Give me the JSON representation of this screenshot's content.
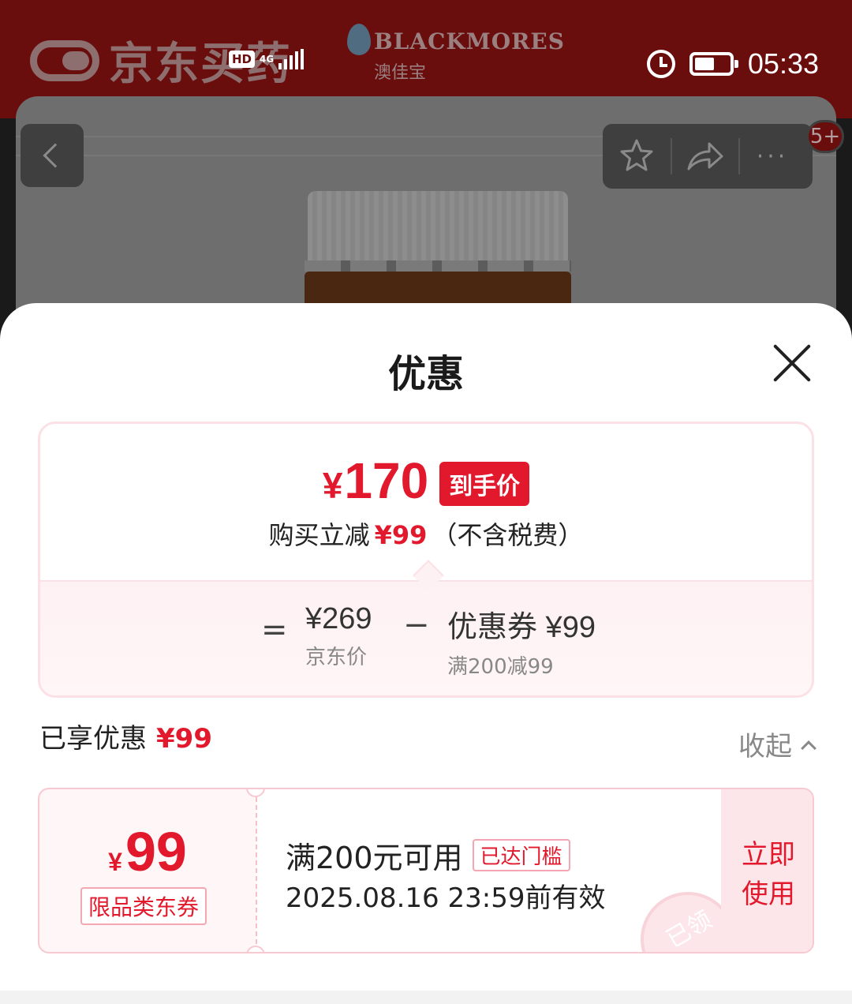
{
  "background": {
    "app_logo_text": "京东买药",
    "brand_name": "BLACKMORES",
    "brand_sub": "澳佳宝",
    "cart_badge": "5+",
    "more_label": "···"
  },
  "status_bar": {
    "hd": "HD",
    "network": "4G",
    "time": "05:33"
  },
  "sheet": {
    "title": "优惠",
    "final_price": {
      "yen": "¥",
      "amount": "170",
      "tag": "到手价"
    },
    "reduction": {
      "prefix": "购买立减",
      "amount": "¥99",
      "suffix": "（不含税费）"
    },
    "calc": {
      "equals": "=",
      "jd_price": "¥269",
      "jd_price_label": "京东价",
      "minus": "−",
      "coupon_amount": "优惠券 ¥99",
      "coupon_rule": "满200减99"
    },
    "enjoyed": {
      "label": "已享优惠",
      "amount": "¥99"
    },
    "collapse_label": "收起",
    "coupon": {
      "yen": "¥",
      "amount": "99",
      "type": "限品类东券",
      "condition": "满200元可用",
      "reached": "已达门槛",
      "validity": "2025.08.16 23:59前有效",
      "stamp": "已领",
      "use_line1": "立即",
      "use_line2": "使用"
    }
  }
}
